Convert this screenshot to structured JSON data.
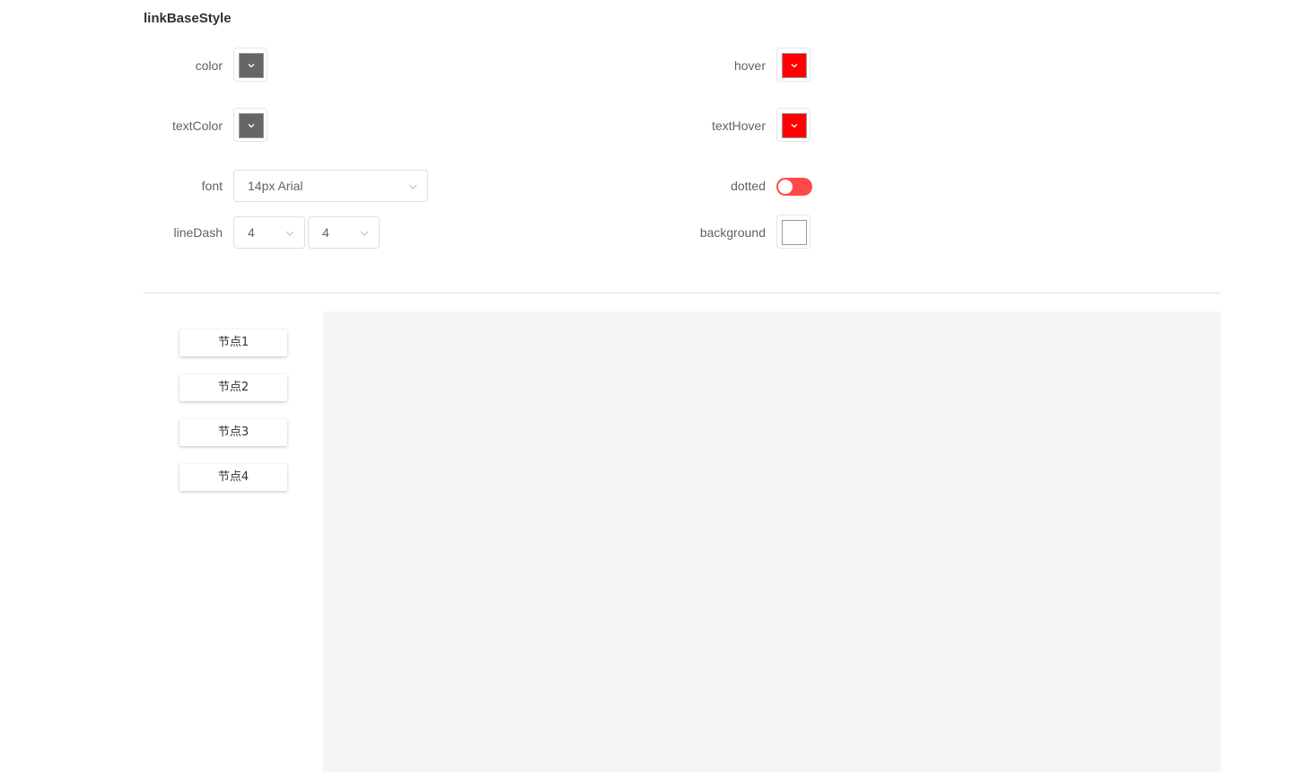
{
  "section": {
    "title": "linkBaseStyle"
  },
  "form": {
    "color": {
      "label": "color",
      "value": "#666666"
    },
    "hover": {
      "label": "hover",
      "value": "#ff0000"
    },
    "textColor": {
      "label": "textColor",
      "value": "#666666"
    },
    "textHover": {
      "label": "textHover",
      "value": "#ff0000"
    },
    "font": {
      "label": "font",
      "value": "14px Arial"
    },
    "dotted": {
      "label": "dotted",
      "on": false,
      "track_color": "#ff4949"
    },
    "lineDash": {
      "label": "lineDash",
      "value1": "4",
      "value2": "4"
    },
    "background": {
      "label": "background",
      "value": "#ffffff"
    }
  },
  "nodes": [
    {
      "label": "节点1"
    },
    {
      "label": "节点2"
    },
    {
      "label": "节点3"
    },
    {
      "label": "节点4"
    }
  ],
  "icons": {
    "picker": "chevron-down-icon",
    "select": "chevron-down-icon"
  }
}
